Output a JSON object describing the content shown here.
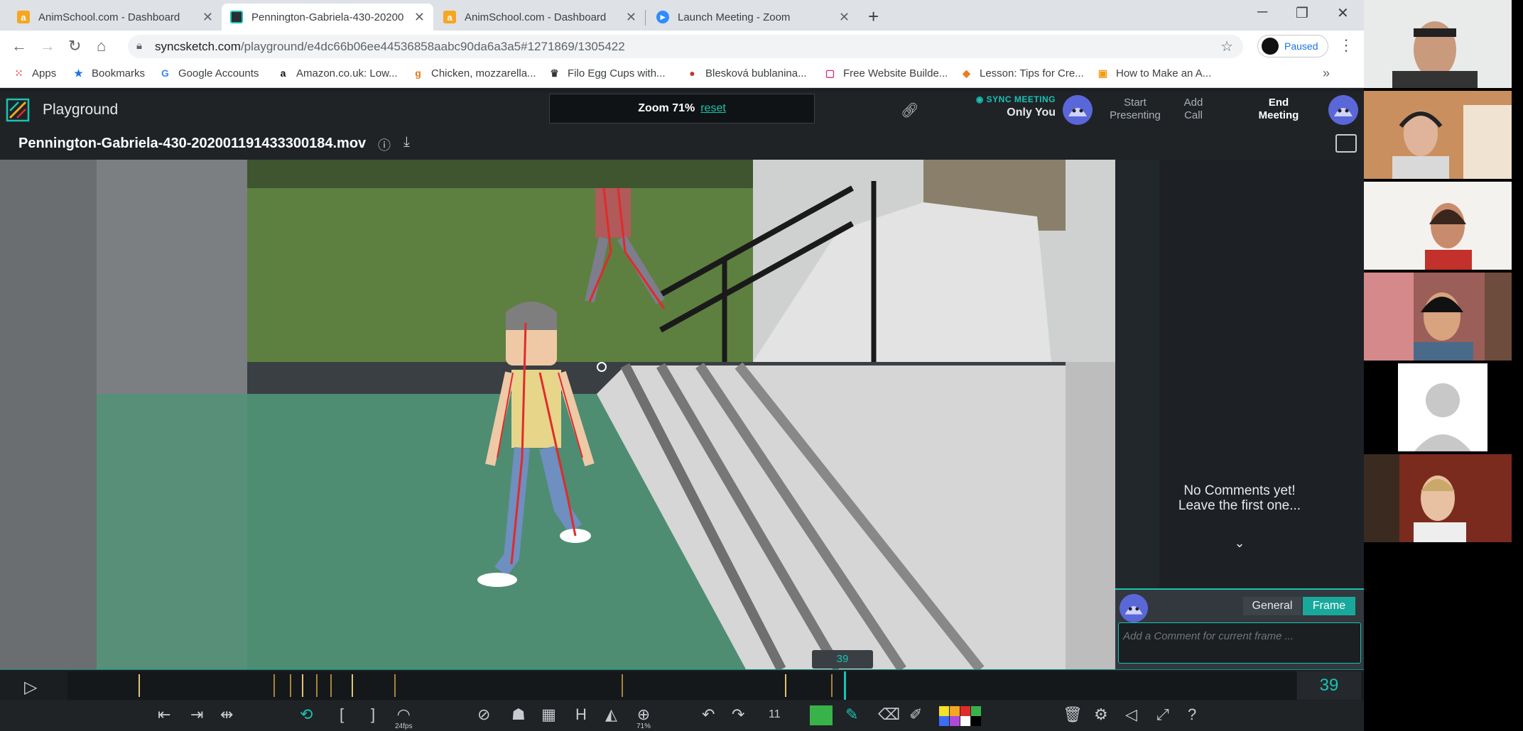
{
  "browser": {
    "tabs": [
      {
        "title": "AnimSchool.com - Dashboard",
        "favicon": "animschool-icon",
        "active": false
      },
      {
        "title": "Pennington-Gabriela-430-20200",
        "favicon": "syncsketch-icon",
        "active": true
      },
      {
        "title": "AnimSchool.com - Dashboard",
        "favicon": "animschool-icon",
        "active": false
      },
      {
        "title": "Launch Meeting - Zoom",
        "favicon": "zoom-icon",
        "active": false
      }
    ],
    "url_host": "syncsketch.com",
    "url_path": "/playground/e4dc66b06ee44536858aabc90da6a3a5#1271869/1305422",
    "profile_status": "Paused",
    "bookmarks": [
      {
        "label": "Apps",
        "icon": "apps-grid-icon"
      },
      {
        "label": "Bookmarks",
        "icon": "star-icon"
      },
      {
        "label": "Google Accounts",
        "icon": "google-icon"
      },
      {
        "label": "Amazon.co.uk: Low...",
        "icon": "amazon-icon"
      },
      {
        "label": "Chicken, mozzarella...",
        "icon": "recipe-icon"
      },
      {
        "label": "Filo Egg Cups with...",
        "icon": "crown-icon"
      },
      {
        "label": "Blesková bublanina...",
        "icon": "cake-icon"
      },
      {
        "label": "Free Website Builde...",
        "icon": "builder-icon"
      },
      {
        "label": "Lesson: Tips for Cre...",
        "icon": "fox-icon"
      },
      {
        "label": "How to Make an A...",
        "icon": "video-icon"
      }
    ]
  },
  "syncsketch": {
    "app_title": "Playground",
    "zoom_label": "Zoom 71%",
    "zoom_reset": "reset",
    "sync_meeting_label": "SYNC MEETING",
    "sync_meeting_value": "Only You",
    "actions": {
      "start_presenting": "Start Presenting",
      "add_call": "Add Call",
      "end_meeting": "End Meeting"
    },
    "file_name": "Pennington-Gabriela-430-202001191433300184.mov",
    "no_comments": [
      "No Comments yet!",
      "Leave the first one..."
    ],
    "comment_tabs": {
      "general": "General",
      "frame": "Frame"
    },
    "comment_placeholder": "Add a Comment for current frame  ...",
    "current_frame": "39",
    "toolbar": {
      "fps_label": "24fps",
      "zoom_label": "71%",
      "frame_step": "11"
    },
    "colors": {
      "accent": "#19c3b4",
      "bg": "#1f2326",
      "tick": "#a7853a",
      "palette": [
        "#f5e125",
        "#f5a623",
        "#e02b2b",
        "#38b34a",
        "#3b6ef5",
        "#b04ad6",
        "#ffffff",
        "#000000"
      ]
    }
  },
  "zoom_participants": [
    {
      "name": "participant-1"
    },
    {
      "name": "participant-2"
    },
    {
      "name": "participant-3"
    },
    {
      "name": "participant-4"
    },
    {
      "name": "participant-5"
    },
    {
      "name": "participant-6"
    }
  ]
}
